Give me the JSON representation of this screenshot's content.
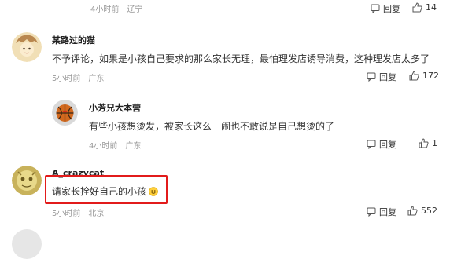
{
  "comments": [
    {
      "time": "4小时前",
      "location": "辽宁",
      "reply_label": "回复",
      "likes": "14"
    },
    {
      "user": "某路过的猫",
      "text": "不予评论，如果是小孩自己要求的那么家长无理，最怕理发店诱导消费，这种理发店太多了",
      "time": "5小时前",
      "location": "广东",
      "reply_label": "回复",
      "likes": "172"
    },
    {
      "user": "小芳兄大本营",
      "text": "有些小孩想烫发，被家长这么一闹也不敢说是自己想烫的了",
      "time": "4小时前",
      "location": "广东",
      "reply_label": "回复",
      "likes": "1"
    },
    {
      "user": "A_crazycat",
      "text": "请家长拴好自己的小孩",
      "time": "5小时前",
      "location": "北京",
      "reply_label": "回复",
      "likes": "552"
    }
  ],
  "colors": {
    "highlight": "#e21b1b",
    "meta": "#999999"
  },
  "icons": {
    "reply": "speech-bubble-icon",
    "like": "thumbs-up-icon",
    "emoji": "smile-emoji-icon"
  }
}
